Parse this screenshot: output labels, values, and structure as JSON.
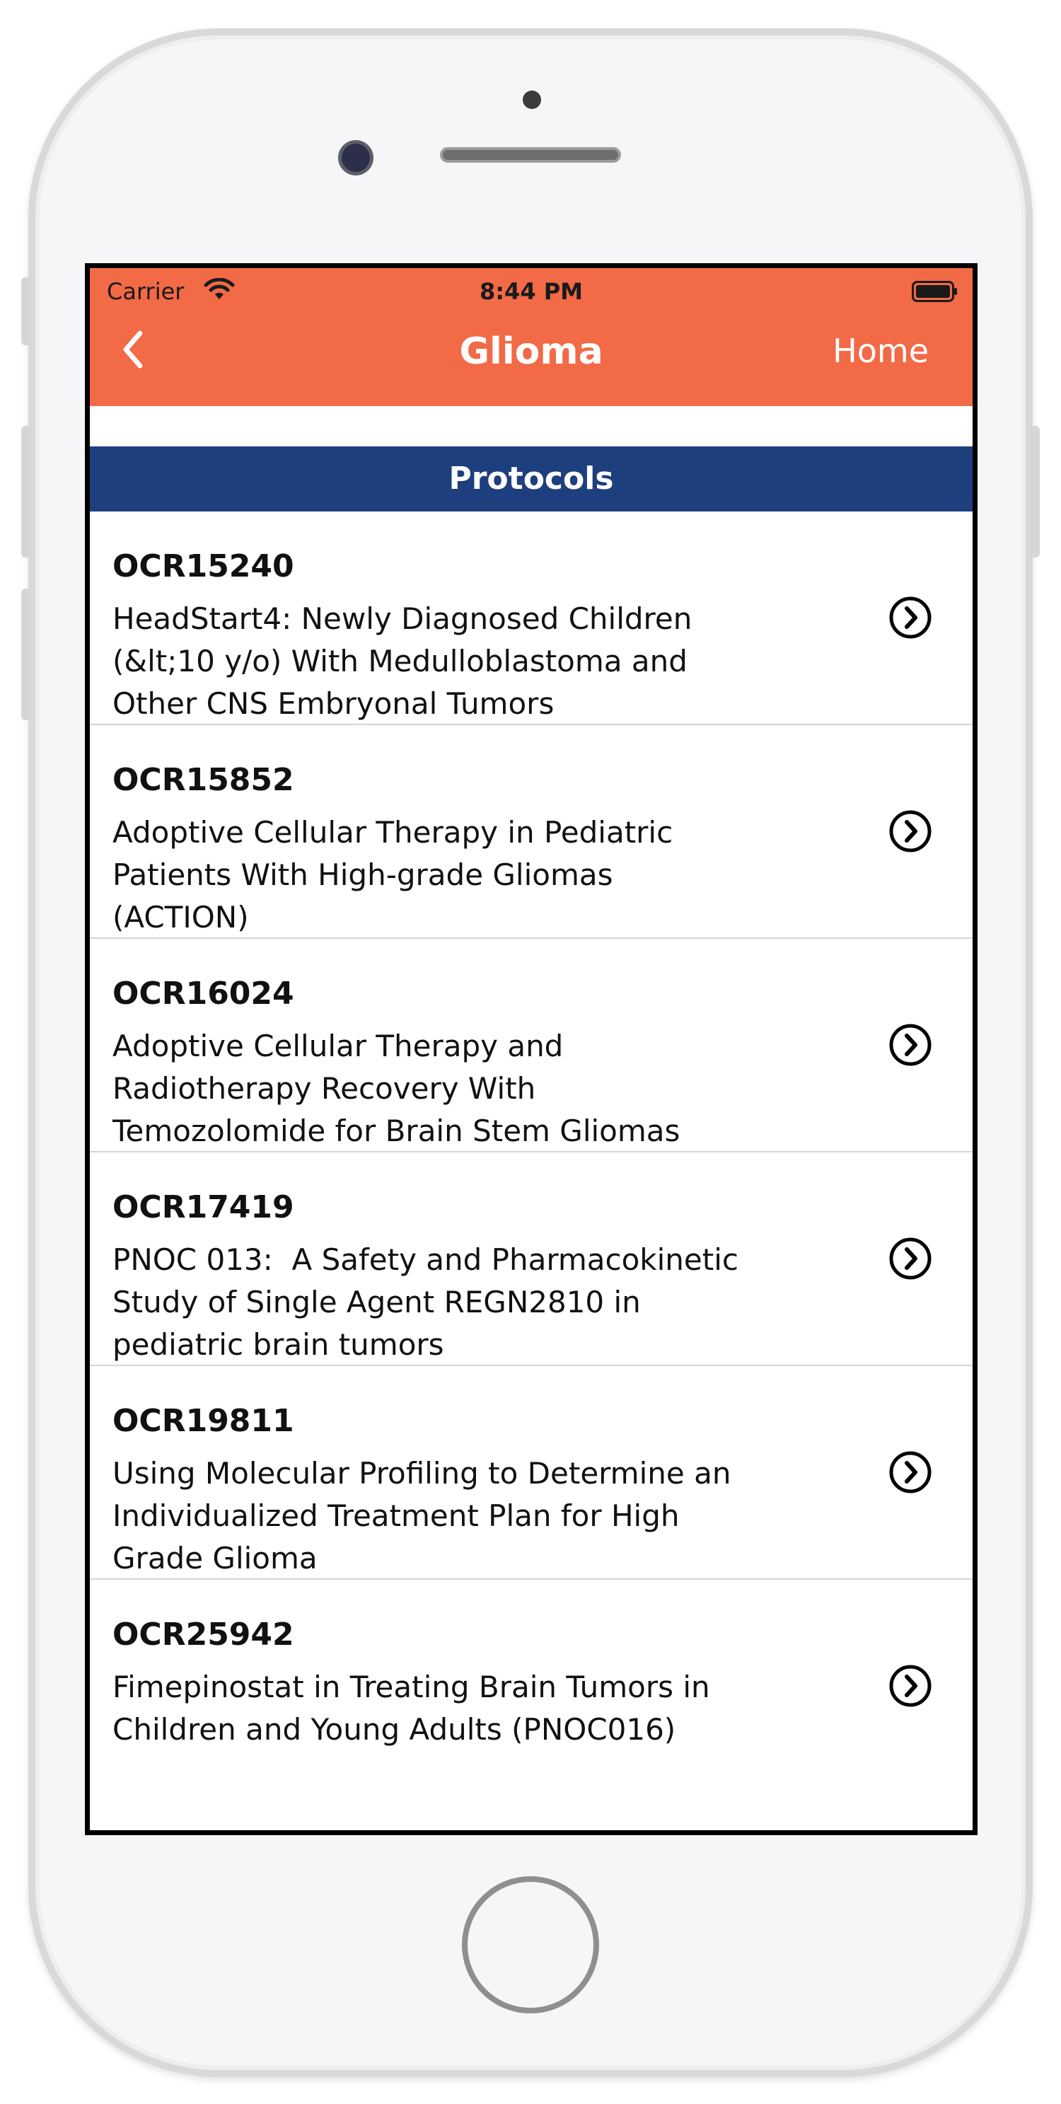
{
  "status_bar": {
    "carrier": "Carrier",
    "time": "8:44 PM",
    "wifi_icon": "wifi-icon",
    "battery_icon": "battery-icon"
  },
  "nav": {
    "title": "Glioma",
    "home_label": "Home",
    "back_icon": "chevron-left-icon"
  },
  "section": {
    "title": "Protocols"
  },
  "protocols": [
    {
      "id": "OCR15240",
      "title": "HeadStart4: Newly Diagnosed Children\n(&lt;10 y/o) With Medulloblastoma and\nOther CNS Embryonal Tumors"
    },
    {
      "id": "OCR15852",
      "title": "Adoptive Cellular Therapy in Pediatric\nPatients With High-grade Gliomas\n(ACTION)"
    },
    {
      "id": "OCR16024",
      "title": "Adoptive Cellular Therapy and\nRadiotherapy Recovery With\nTemozolomide for Brain Stem Gliomas"
    },
    {
      "id": "OCR17419",
      "title": "PNOC 013:  A Safety and Pharmacokinetic\nStudy of Single Agent REGN2810 in\npediatric brain tumors"
    },
    {
      "id": "OCR19811",
      "title": "Using Molecular Profiling to Determine an\nIndividualized Treatment Plan for High\nGrade Glioma"
    },
    {
      "id": "OCR25942",
      "title": "Fimepinostat in Treating Brain Tumors in\nChildren and Young Adults (PNOC016)"
    }
  ],
  "colors": {
    "nav_background": "#f26a46",
    "section_background": "#1e3f7d",
    "text": "#111111",
    "divider": "#d6d6d6"
  }
}
